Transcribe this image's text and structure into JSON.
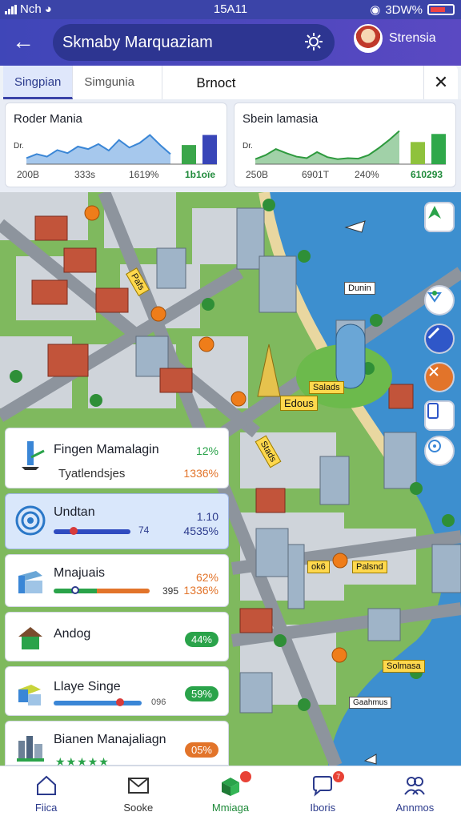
{
  "status_bar": {
    "carrier": "Nch",
    "time": "15A11",
    "battery": "3DW%"
  },
  "header": {
    "title": "Skmaby Marquaziam",
    "profile_name": "Strensia"
  },
  "tabs": [
    {
      "label": "Singpian",
      "active": true
    },
    {
      "label": "Simgunia",
      "active": false
    },
    {
      "label": "Brnoct",
      "active": false
    }
  ],
  "charts": [
    {
      "title": "Roder Mania",
      "y_axis_label": "Dr.",
      "ticks": [
        "200B",
        "333s",
        "1619%",
        "1b1oïe"
      ],
      "chart_data": {
        "type": "area",
        "values": [
          12,
          20,
          15,
          28,
          22,
          35,
          30,
          40,
          27,
          48,
          33,
          42,
          58,
          38,
          20
        ],
        "bars": [
          38,
          58
        ],
        "color": "#3a86d6",
        "bar_colors": [
          "#3aa64a",
          "#3845b8"
        ]
      }
    },
    {
      "title": "Sbein lamasia",
      "y_axis_label": "Dr.",
      "ticks": [
        "250B",
        "6901T",
        "240%",
        "610293"
      ],
      "chart_data": {
        "type": "area",
        "values": [
          10,
          18,
          30,
          22,
          15,
          12,
          24,
          14,
          10,
          12,
          11,
          18,
          32,
          48,
          66
        ],
        "bars": [
          44,
          60
        ],
        "color": "#2e9a3e",
        "bar_colors": [
          "#8fc23c",
          "#2fa84a"
        ]
      }
    }
  ],
  "map_labels": [
    "Pafs",
    "Dunin",
    "Salads",
    "Edous",
    "Stads",
    "ok6",
    "Palsnd",
    "Solmasa",
    "Gaahmus"
  ],
  "list_items": [
    {
      "name": "Fingen Mamalagin",
      "sub": "Tyatlendsjes",
      "v1": "12%",
      "v2": "1336%",
      "icon": "tower-icon"
    },
    {
      "name": "Undtan",
      "v1": "1.10",
      "v2": "4535%",
      "slider_label": "74",
      "progress": 0.74,
      "icon": "spiral-icon"
    },
    {
      "name": "Mnajuais",
      "v1": "62%",
      "v2": "1336%",
      "slider_label": "395",
      "progress": 0.26,
      "icon": "building-icon"
    },
    {
      "name": "Andog",
      "pill": "44%",
      "icon": "house-icon"
    },
    {
      "name": "Llaye Singe",
      "pill": "59%",
      "slider_label": "096",
      "progress": 0.68,
      "icon": "factory-icon"
    },
    {
      "name": "Bianen Manajaliagn",
      "pill": "05%",
      "rating": "★★★★★",
      "icon": "city-icon"
    }
  ],
  "bottom_nav": [
    {
      "label": "Fiica",
      "icon": "home-icon"
    },
    {
      "label": "Sooke",
      "icon": "mail-icon"
    },
    {
      "label": "Mmiaga",
      "icon": "cube-icon",
      "badge": ""
    },
    {
      "label": "Iboris",
      "icon": "chat-icon",
      "badge": "7"
    },
    {
      "label": "Annmos",
      "icon": "people-icon"
    }
  ],
  "colors": {
    "primary": "#3b44a8",
    "accent_green": "#2aa34a",
    "accent_orange": "#e2742a"
  }
}
